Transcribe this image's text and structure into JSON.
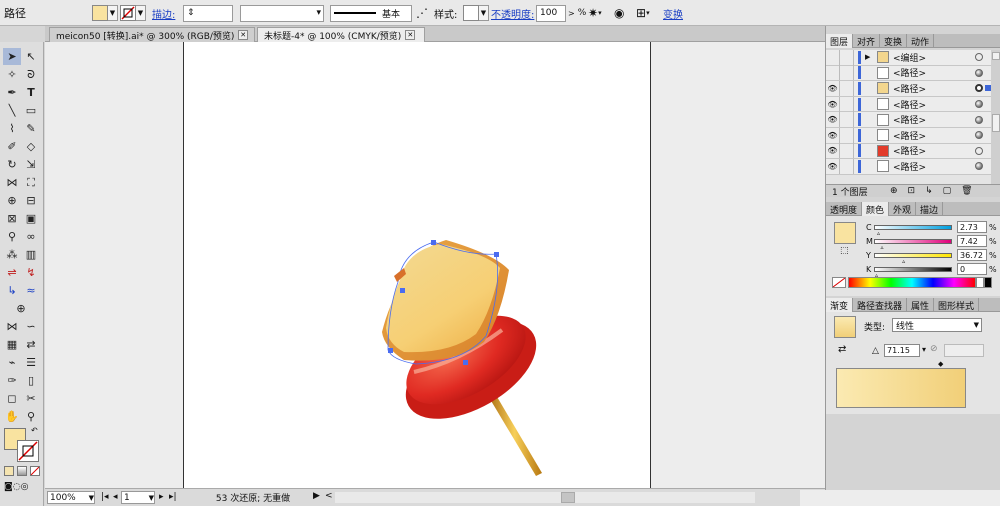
{
  "control_bar": {
    "mode_label": "路径",
    "stroke_label": "描边:",
    "brush_label": "基本",
    "style_label": "样式:",
    "opacity_label": "不透明度:",
    "opacity_value": "100",
    "opacity_unit": "%",
    "transform_label": "变换",
    "fill_color": "#f9e3a0"
  },
  "doc_tabs": [
    {
      "label": "meicon50 [转换].ai* @ 300% (RGB/预览)"
    },
    {
      "label": "未标题-4* @ 100% (CMYK/预览)"
    }
  ],
  "status_bar": {
    "zoom": "100%",
    "artboard": "1",
    "history": "53 次还原; 无重做"
  },
  "layers_panel": {
    "tabs": [
      "图层",
      "对齐",
      "变换",
      "动作"
    ],
    "rows": [
      {
        "name": "<编组>",
        "visible": false,
        "thumb_color": "#f3d68e",
        "target": "empty",
        "expander": true
      },
      {
        "name": "<路径>",
        "visible": false,
        "thumb_color": "#ffffff",
        "target": "filled"
      },
      {
        "name": "<路径>",
        "visible": true,
        "thumb_color": "#f3d68e",
        "target": "selected"
      },
      {
        "name": "<路径>",
        "visible": true,
        "thumb_color": "#ffffff",
        "target": "filled"
      },
      {
        "name": "<路径>",
        "visible": true,
        "thumb_color": "#ffffff",
        "target": "filled"
      },
      {
        "name": "<路径>",
        "visible": true,
        "thumb_color": "#ffffff",
        "target": "filled"
      },
      {
        "name": "<路径>",
        "visible": true,
        "thumb_color": "#e23b2a",
        "target": "empty"
      },
      {
        "name": "<路径>",
        "visible": true,
        "thumb_color": "#ffffff",
        "target": "filled"
      }
    ],
    "footer_label": "1 个图层"
  },
  "color_panel": {
    "tabs": [
      "透明度",
      "颜色",
      "外观",
      "描边"
    ],
    "channels": [
      {
        "label": "C",
        "value": "2.73",
        "gradient": "linear-gradient(90deg,#fff,#00a0e0)",
        "pos": 0.0273
      },
      {
        "label": "M",
        "value": "7.42",
        "gradient": "linear-gradient(90deg,#fff,#e0007a)",
        "pos": 0.0742
      },
      {
        "label": "Y",
        "value": "36.72",
        "gradient": "linear-gradient(90deg,#fff,#ffe600)",
        "pos": 0.3672
      },
      {
        "label": "K",
        "value": "0",
        "gradient": "linear-gradient(90deg,#fff,#000)",
        "pos": 0
      }
    ],
    "unit": "%"
  },
  "gradient_panel": {
    "tabs": [
      "渐变",
      "路径查找器",
      "属性",
      "图形样式"
    ],
    "type_label": "类型:",
    "type_value": "线性",
    "angle_value": "71.15"
  }
}
